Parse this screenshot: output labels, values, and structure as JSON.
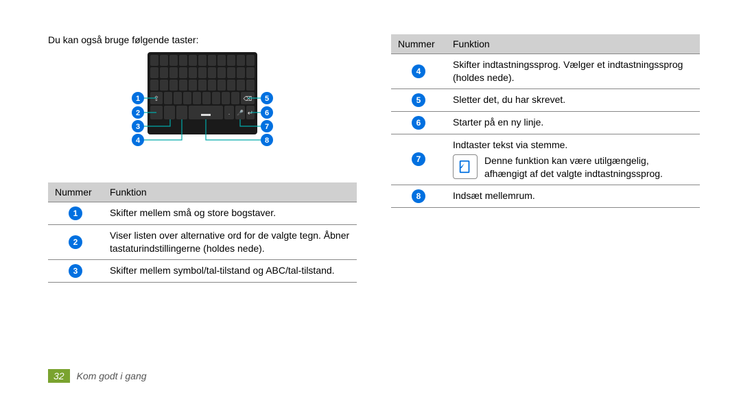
{
  "intro": "Du kan også bruge følgende taster:",
  "callouts_left": [
    "1",
    "2",
    "3",
    "4"
  ],
  "callouts_right": [
    "5",
    "6",
    "7",
    "8"
  ],
  "table_left": {
    "headers": [
      "Nummer",
      "Funktion"
    ],
    "rows": [
      {
        "num": "1",
        "text": "Skifter mellem små og store bogstaver."
      },
      {
        "num": "2",
        "text": "Viser listen over alternative ord for de valgte tegn. Åbner tastaturindstillingerne (holdes nede)."
      },
      {
        "num": "3",
        "text": "Skifter mellem symbol/tal-tilstand og ABC/tal-tilstand."
      }
    ]
  },
  "table_right": {
    "headers": [
      "Nummer",
      "Funktion"
    ],
    "rows": [
      {
        "num": "4",
        "text": "Skifter indtastningssprog. Vælger et indtastningssprog (holdes nede)."
      },
      {
        "num": "5",
        "text": "Sletter det, du har skrevet."
      },
      {
        "num": "6",
        "text": "Starter på en ny linje."
      },
      {
        "num": "7",
        "text": "Indtaster tekst via stemme.",
        "note": "Denne funktion kan være utilgængelig, afhængigt af det valgte indtastningssprog."
      },
      {
        "num": "8",
        "text": "Indsæt mellemrum."
      }
    ]
  },
  "footer": {
    "page": "32",
    "section": "Kom godt i gang"
  }
}
